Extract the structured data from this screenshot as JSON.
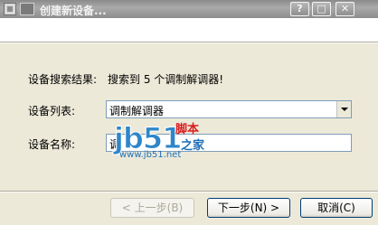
{
  "window": {
    "title": "创建新设备...",
    "help_glyph": "?",
    "maximize_glyph": "□",
    "close_glyph": "✕"
  },
  "form": {
    "search_result_label": "设备搜索结果:",
    "search_result_value": "搜索到 5 个调制解调器!",
    "device_list_label": "设备列表:",
    "device_list_value": "调制解调器",
    "device_name_label": "设备名称:",
    "device_name_value": "调"
  },
  "watermark": {
    "logo": "jb51",
    "tag1": "脚本",
    "tag2": "之家",
    "url": "www.jb51.net"
  },
  "buttons": {
    "prev": "< 上一步(B)",
    "next": "下一步(N) >",
    "cancel": "取消(C)"
  },
  "colors": {
    "titlebar": "#9C9C9C",
    "dialog_bg": "#ECE9D8",
    "watermark_blue": "#2E86C8",
    "watermark_red": "#D81E1E"
  }
}
